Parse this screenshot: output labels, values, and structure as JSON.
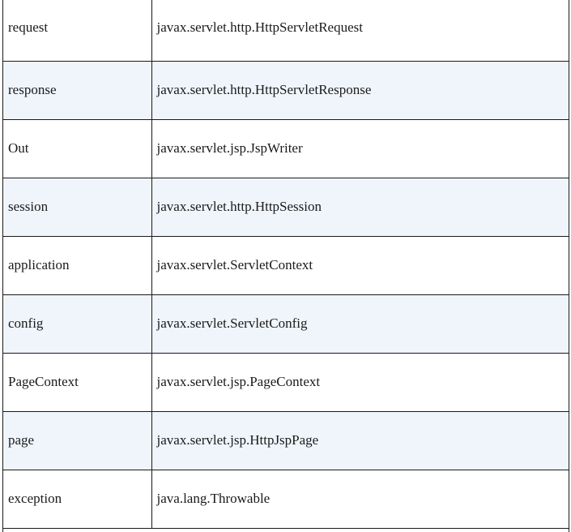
{
  "table": {
    "rows": [
      {
        "name": "request",
        "type": "javax.servlet.http.HttpServletRequest"
      },
      {
        "name": "response",
        "type": "javax.servlet.http.HttpServletResponse"
      },
      {
        "name": "Out",
        "type": "javax.servlet.jsp.JspWriter"
      },
      {
        "name": "session",
        "type": "javax.servlet.http.HttpSession"
      },
      {
        "name": "application",
        "type": "javax.servlet.ServletContext"
      },
      {
        "name": "config",
        "type": "javax.servlet.ServletConfig"
      },
      {
        "name": "PageContext",
        "type": "javax.servlet.jsp.PageContext"
      },
      {
        "name": "page",
        "type": "javax.servlet.jsp.HttpJspPage"
      },
      {
        "name": "exception",
        "type": "java.lang.Throwable"
      }
    ],
    "colors": {
      "shaded_row": "#f0f5fc",
      "border": "#1a1a1a"
    }
  }
}
